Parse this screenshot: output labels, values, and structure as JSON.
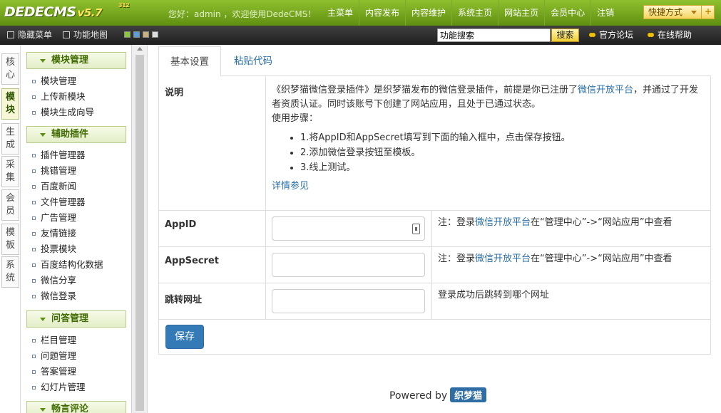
{
  "app": {
    "logo": "DEDECMS",
    "version": "v5.7",
    "version_sup": "312"
  },
  "header": {
    "welcome": "您好：admin ，欢迎使用DedeCMS！",
    "nav": [
      "主菜单",
      "内容发布",
      "内容维护",
      "系统主页",
      "网站主页",
      "会员中心",
      "注销"
    ],
    "quick_label": "快捷方式",
    "quick_plus": "+"
  },
  "toolbar": {
    "hide_menu": "隐藏菜单",
    "func_map": "功能地图",
    "skins": [
      "#8cc63f",
      "#5aa0d8",
      "#c8b080",
      "#dddddd"
    ],
    "search_value": "功能搜索",
    "search_button": "搜索",
    "forum": "官方论坛",
    "help": "在线帮助"
  },
  "vtabs": [
    {
      "label": "核心",
      "active": false
    },
    {
      "label": "模块",
      "active": true
    },
    {
      "label": "生成",
      "active": false
    },
    {
      "label": "采集",
      "active": false
    },
    {
      "label": "会员",
      "active": false
    },
    {
      "label": "模板",
      "active": false
    },
    {
      "label": "系统",
      "active": false
    }
  ],
  "sidebar": {
    "groups": [
      {
        "title": "模块管理",
        "items": [
          "模块管理",
          "上传新模块",
          "模块生成向导"
        ]
      },
      {
        "title": "辅助插件",
        "items": [
          "插件管理器",
          "挑错管理",
          "百度新闻",
          "文件管理器",
          "广告管理",
          "友情链接",
          "投票模块",
          "百度结构化数据",
          "微信分享",
          "微信登录"
        ]
      },
      {
        "title": "问答管理",
        "items": [
          "栏目管理",
          "问题管理",
          "答案管理",
          "幻灯片管理"
        ]
      },
      {
        "title": "畅言评论",
        "items": []
      }
    ]
  },
  "tabs": {
    "basic": "基本设置",
    "paste": "粘贴代码"
  },
  "form": {
    "desc_label": "说明",
    "desc_text1": "《织梦猫微信登录插件》是织梦猫发布的微信登录插件，前提是你已注册了",
    "desc_link": "微信开放平台",
    "desc_text2": "，并通过了开发者资质认证。同时该账号下创建了网站应用，且处于已通过状态。",
    "steps_title": "使用步骤：",
    "steps": [
      "1.将AppID和AppSecret填写到下面的输入框中，点击保存按钮。",
      "2.添加微信登录按钮至模板。",
      "3.线上测试。"
    ],
    "details_link": "详情参见",
    "appid_label": "AppID",
    "appid_value": "",
    "appsecret_label": "AppSecret",
    "appsecret_value": "",
    "redirect_label": "跳转网址",
    "redirect_value": "",
    "note_prefix": "注：登录",
    "note_link": "微信开放平台",
    "note_suffix": "在“管理中心”->“网站应用”中查看",
    "redirect_note": "登录成功后跳转到哪个网址",
    "save": "保存"
  },
  "footer": {
    "powered": "Powered by",
    "brand": "织梦猫"
  }
}
